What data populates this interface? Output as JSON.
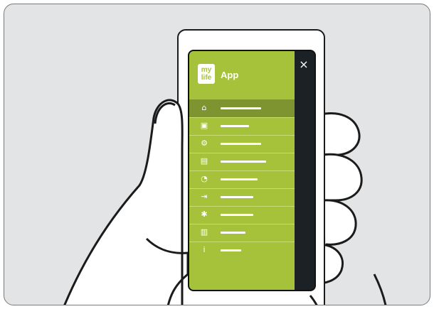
{
  "app": {
    "logo_text_line1": "my",
    "logo_text_line2": "life",
    "title": "App",
    "close_symbol": "×"
  },
  "menu": {
    "items": [
      {
        "icon": "home-icon",
        "glyph": "⌂",
        "active": true,
        "bar_fraction": 0.62
      },
      {
        "icon": "device-icon",
        "glyph": "▣",
        "active": false,
        "bar_fraction": 0.44
      },
      {
        "icon": "settings-device-icon",
        "glyph": "⚙",
        "active": false,
        "bar_fraction": 0.62
      },
      {
        "icon": "document-icon",
        "glyph": "▤",
        "active": false,
        "bar_fraction": 0.7
      },
      {
        "icon": "chart-icon",
        "glyph": "◔",
        "active": false,
        "bar_fraction": 0.57
      },
      {
        "icon": "export-icon",
        "glyph": "⇥",
        "active": false,
        "bar_fraction": 0.5
      },
      {
        "icon": "gear-icon",
        "glyph": "✱",
        "active": false,
        "bar_fraction": 0.5
      },
      {
        "icon": "book-icon",
        "glyph": "▥",
        "active": false,
        "bar_fraction": 0.38
      },
      {
        "icon": "info-icon",
        "glyph": "i",
        "active": false,
        "bar_fraction": 0.31
      }
    ]
  },
  "colors": {
    "drawer": "#a6c23a",
    "active_item": "#7e9430",
    "screen_dark": "#1c2126",
    "background": "#e3e4e5"
  }
}
